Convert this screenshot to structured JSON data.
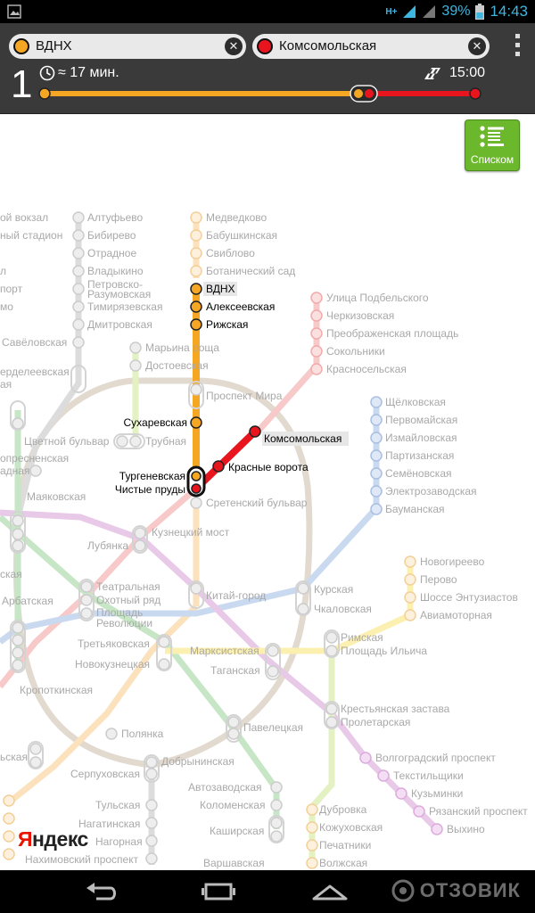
{
  "status_bar": {
    "network": "H+",
    "battery": "39%",
    "time": "14:43"
  },
  "route": {
    "from": {
      "label": "ВДНХ",
      "color": "#f5a623"
    },
    "to": {
      "label": "Комсомольская",
      "color": "#e8141e"
    },
    "number": "1",
    "duration": "≈ 17 мин.",
    "arrival": "15:00",
    "bar_colors": {
      "orange": "#f5a623",
      "red": "#e8141e"
    }
  },
  "list_button": {
    "label": "Списком"
  },
  "brand": {
    "first": "Я",
    "rest": "ндекс"
  },
  "watermark": "ОТЗОВИК",
  "map": {
    "active_stations": [
      "ВДНХ",
      "Алексеевская",
      "Рижская",
      "Сухаревская",
      "Тургеневская",
      "Чистые пруды",
      "Красные ворота",
      "Комсомольская"
    ],
    "stations": [
      "ой вокзал",
      "ный стадион",
      "л",
      "порт",
      "мо",
      "Савёловская",
      "ерделеевская",
      "ая",
      "опресненская",
      "адная",
      "Цветной бульвар",
      "Маяковская",
      "ская",
      "Арбатская",
      "Кропоткинская",
      "ьская",
      "Нахимовский проспект",
      "Алтуфьево",
      "Бибирево",
      "Отрадное",
      "Владыкино",
      "Петровско-",
      "Разумовская",
      "Тимирязевская",
      "Дмитровская",
      "Медведково",
      "Бабушкинская",
      "Свиблово",
      "Ботанический сад",
      "Марьина роща",
      "Достоевская",
      "Проспект Мира",
      "Трубная",
      "Сретенский бульвар",
      "Улица Подбельского",
      "Черкизовская",
      "Преображенская площадь",
      "Сокольники",
      "Красносельская",
      "Щёлковская",
      "Первомайская",
      "Измайловская",
      "Партизанская",
      "Семёновская",
      "Электрозаводская",
      "Бауманская",
      "Кузнецкий мост",
      "Лубянка",
      "Театральная",
      "Охотный ряд",
      "Площадь",
      "Революции",
      "Китай-город",
      "Курская",
      "Чкаловская",
      "Новогиреево",
      "Перово",
      "Шоссе Энтузиастов",
      "Авиамоторная",
      "Третьяковская",
      "Новокузнецкая",
      "Марксистская",
      "Таганская",
      "Римская",
      "Площадь Ильича",
      "Полянка",
      "Павелецкая",
      "Крестьянская застава",
      "Пролетарская",
      "Волгоградский проспект",
      "Текстильщики",
      "Кузьминки",
      "Рязанский проспект",
      "Выхино",
      "Серпуховская",
      "Добрынинская",
      "Автозаводская",
      "Коломенская",
      "Каширская",
      "Варшавская",
      "Тульская",
      "Нагатинская",
      "Нагорная",
      "Дубровка",
      "Кожуховская",
      "Печатники",
      "Волжская"
    ],
    "line_colors": {
      "sokolnicheskaya": "#f7c9c9",
      "zamoskvoretskaya": "#c6e6c6",
      "arbatskaya": "#c9d9f0",
      "filevskaya": "#cfe9f7",
      "koltsevaya": "#e2d9cf",
      "kaluzhskaya": "#fbe2bd",
      "tagansko": "#e8c9e8",
      "kalininskaya": "#fbf0b0",
      "serpukhovskaya": "#dcdcdc",
      "lyublinskaya": "#e4f1c2"
    }
  }
}
